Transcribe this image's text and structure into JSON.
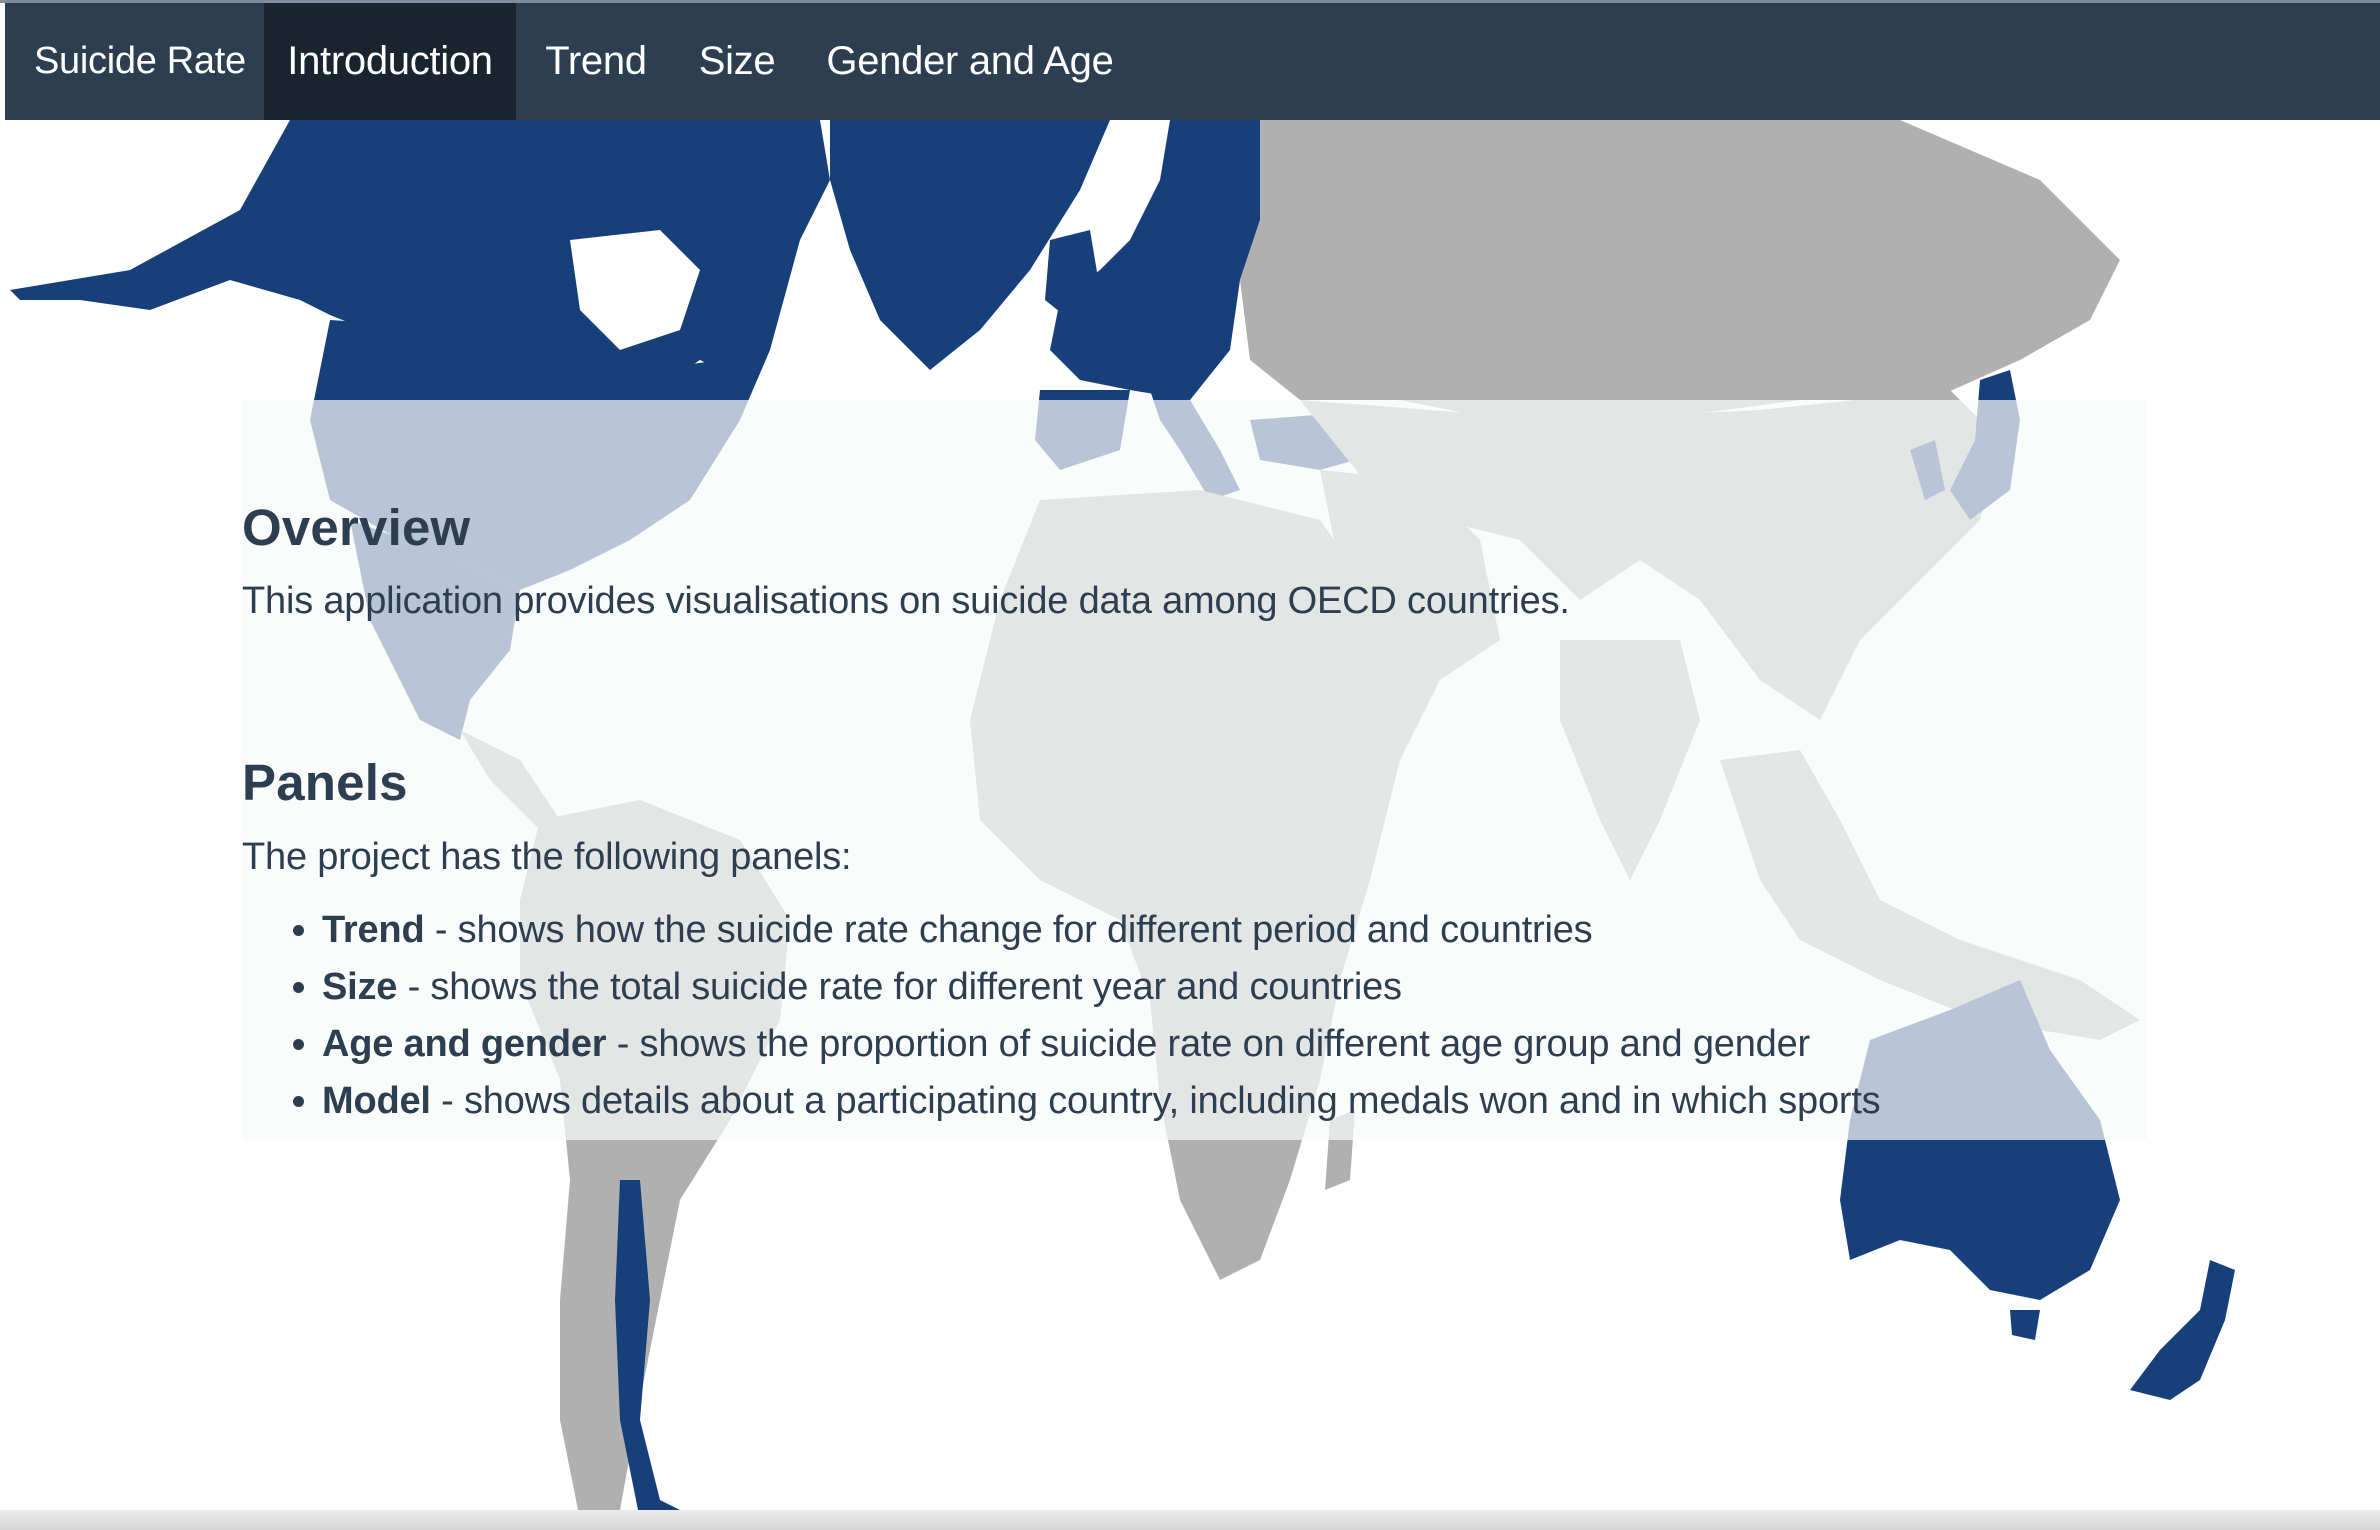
{
  "navbar": {
    "brand": "Suicide Rate",
    "tabs": [
      {
        "label": "Introduction",
        "active": true
      },
      {
        "label": "Trend",
        "active": false
      },
      {
        "label": "Size",
        "active": false
      },
      {
        "label": "Gender and Age",
        "active": false
      }
    ]
  },
  "overview": {
    "heading": "Overview",
    "text": "This application provides visualisations on suicide data among OECD countries."
  },
  "panels": {
    "heading": "Panels",
    "intro": "The project has the following panels:",
    "items": [
      {
        "name": "Trend",
        "description": " - shows how the suicide rate change for different period and countries"
      },
      {
        "name": "Size",
        "description": " - shows the total suicide rate for different year and countries"
      },
      {
        "name": "Age and gender",
        "description": " - shows the proportion of suicide rate on different age group and gender"
      },
      {
        "name": "Model",
        "description": " - shows details about a participating country, including medals won and in which sports"
      }
    ]
  },
  "map": {
    "colors": {
      "oecd": "#173f7a",
      "other": "#b0b0b0",
      "background": "#ffffff",
      "navbar": "#2c3e50",
      "navbar_active": "#1a242f"
    }
  }
}
